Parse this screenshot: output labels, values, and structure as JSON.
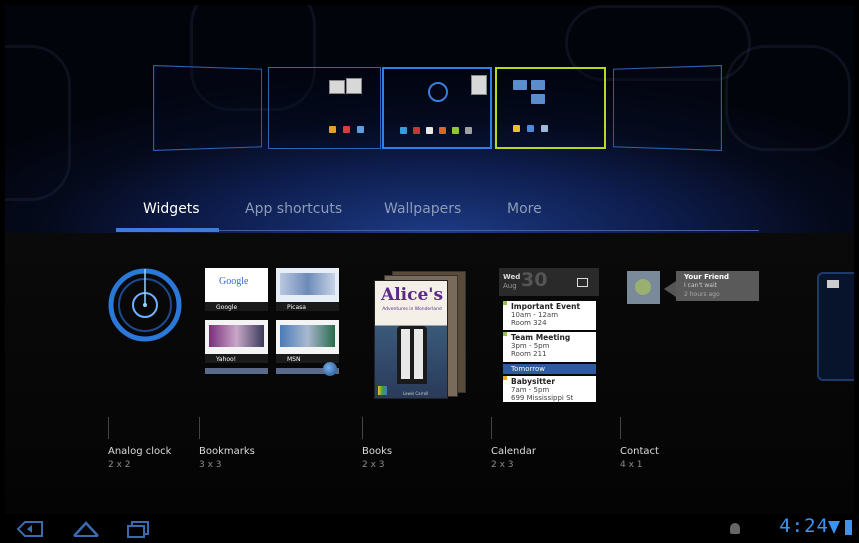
{
  "tabs": [
    {
      "label": "Widgets",
      "active": true
    },
    {
      "label": "App shortcuts",
      "active": false
    },
    {
      "label": "Wallpapers",
      "active": false
    },
    {
      "label": "More",
      "active": false
    }
  ],
  "widgets": [
    {
      "name": "Analog clock",
      "size": "2 x 2"
    },
    {
      "name": "Bookmarks",
      "size": "3 x 3"
    },
    {
      "name": "Books",
      "size": "2 x 3"
    },
    {
      "name": "Calendar",
      "size": "2 x 3"
    },
    {
      "name": "Contact",
      "size": "4 x 1"
    }
  ],
  "bookmarks_preview": {
    "titles": [
      "Google",
      "Picasa",
      "Yahoo!",
      "MSN"
    ],
    "google_logo": "Google"
  },
  "books_preview": {
    "cover_title": "Alice's",
    "cover_subtitle": "Adventures in Wonderland",
    "footer": "Lewis Carroll"
  },
  "calendar_preview": {
    "day": "Wed",
    "month": "Aug",
    "date": "30",
    "events": [
      {
        "title": "Important Event",
        "time": "10am - 12am",
        "place": "Room 324",
        "color": "#8ec63f"
      },
      {
        "title": "Team Meeting",
        "time": "3pm - 5pm",
        "place": "Room 211",
        "color": "#8ec63f"
      }
    ],
    "divider": "Tomorrow",
    "tomorrow_event": {
      "title": "Babysitter",
      "time": "7am - 5pm",
      "place": "699 Mississippi St",
      "color": "#f5a623"
    }
  },
  "contact_preview": {
    "name": "Your Friend",
    "status": "I can't wait",
    "time": "2 hours ago"
  },
  "status_bar": {
    "time": "4:24"
  },
  "colors": {
    "accent": "#3a7dda",
    "selected_panel": "#b8d81c",
    "clock_blue": "#3b94f1"
  }
}
